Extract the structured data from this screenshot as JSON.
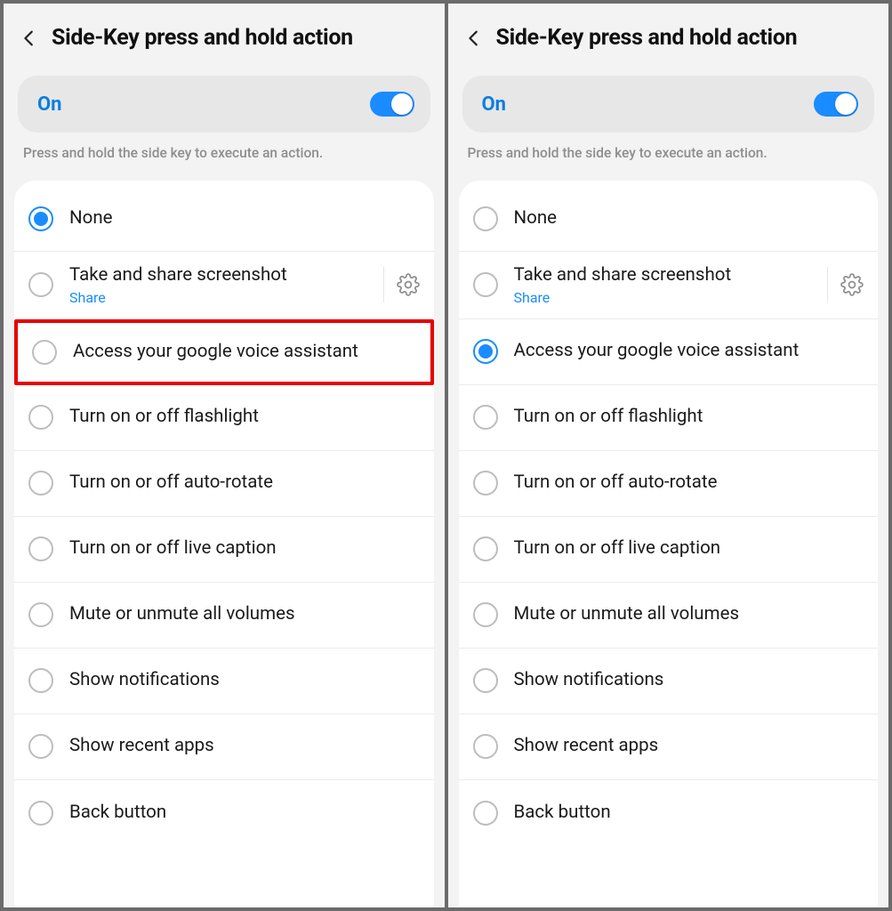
{
  "left": {
    "title": "Side-Key press and hold action",
    "toggle_label": "On",
    "toggle_on": true,
    "hint": "Press and hold the side key to execute an action.",
    "selected_index": 0,
    "highlighted_index": 2,
    "options": [
      {
        "label": "None"
      },
      {
        "label": "Take and share screenshot",
        "sub": "Share",
        "has_gear": true
      },
      {
        "label": "Access your google voice assistant"
      },
      {
        "label": "Turn on or off flashlight"
      },
      {
        "label": "Turn on or off auto-rotate"
      },
      {
        "label": "Turn on or off live caption"
      },
      {
        "label": "Mute or unmute all volumes"
      },
      {
        "label": "Show notifications"
      },
      {
        "label": "Show recent apps"
      },
      {
        "label": "Back button"
      }
    ]
  },
  "right": {
    "title": "Side-Key press and hold action",
    "toggle_label": "On",
    "toggle_on": true,
    "hint": "Press and hold the side key to execute an action.",
    "selected_index": 2,
    "highlighted_index": -1,
    "options": [
      {
        "label": "None"
      },
      {
        "label": "Take and share screenshot",
        "sub": "Share",
        "has_gear": true
      },
      {
        "label": "Access your google voice assistant"
      },
      {
        "label": "Turn on or off flashlight"
      },
      {
        "label": "Turn on or off auto-rotate"
      },
      {
        "label": "Turn on or off live caption"
      },
      {
        "label": "Mute or unmute all volumes"
      },
      {
        "label": "Show notifications"
      },
      {
        "label": "Show recent apps"
      },
      {
        "label": "Back button"
      }
    ]
  }
}
